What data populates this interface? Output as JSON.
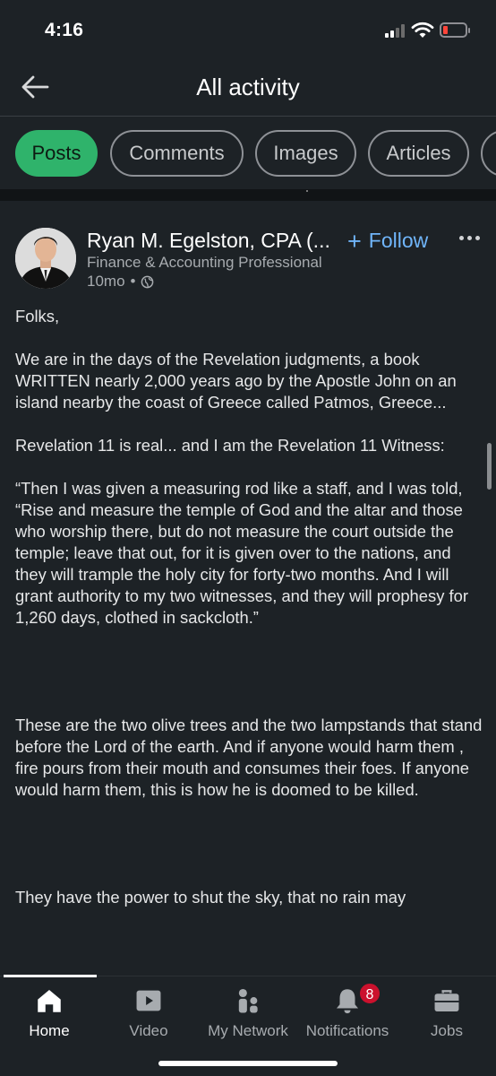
{
  "status_bar": {
    "time": "4:16"
  },
  "header": {
    "title": "All activity"
  },
  "tabs": [
    {
      "label": "Posts"
    },
    {
      "label": "Comments"
    },
    {
      "label": "Images"
    },
    {
      "label": "Articles"
    }
  ],
  "post": {
    "author_name": "Ryan M. Egelston, CPA (...",
    "author_headline": "Finance & Accounting Professional",
    "age": "10mo",
    "meta_separator": "•",
    "follow_label": "Follow",
    "paragraphs": [
      "Folks,",
      "We are in the days of the Revelation judgments, a book WRITTEN nearly 2,000 years ago by the Apostle John on an island nearby the coast of Greece called Patmos, Greece...",
      "Revelation 11 is real... and I am the Revelation 11 Witness:",
      "“Then I was given a measuring rod like a staff, and I was told, “Rise and measure the temple of God and the altar and those who worship there, but do not measure the court outside the temple; leave that out, for it is given over to the nations, and they will trample the holy city for forty-two months. And I will grant authority to my two witnesses, and they will prophesy for 1,260 days, clothed in sackcloth.”",
      "These are the two olive trees  and the two lampstands that stand before the Lord of the earth. And if anyone would harm them , fire pours from their mouth and consumes their foes. If anyone would harm them, this is how he is doomed  to be killed.",
      "They have the power  to shut the sky, that no rain may"
    ]
  },
  "bottom_nav": [
    {
      "label": "Home",
      "icon": "home-icon"
    },
    {
      "label": "Video",
      "icon": "video-icon"
    },
    {
      "label": "My Network",
      "icon": "network-icon"
    },
    {
      "label": "Notifications",
      "icon": "bell-icon",
      "badge": "8"
    },
    {
      "label": "Jobs",
      "icon": "briefcase-icon"
    }
  ],
  "colors": {
    "background": "#1d2226",
    "active_tab": "#2fb36b",
    "link": "#70b5f9",
    "badge": "#cb112d"
  }
}
